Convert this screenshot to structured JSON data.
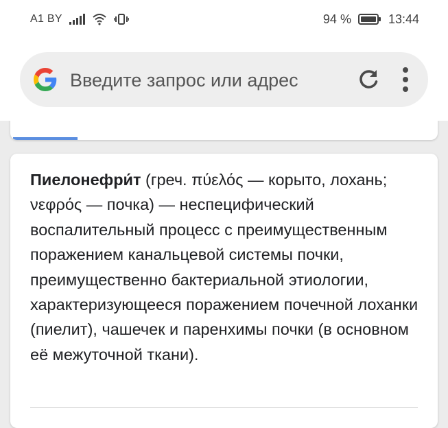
{
  "status_bar": {
    "carrier": "A1 BY",
    "battery_percent": "94 %",
    "time": "13:44"
  },
  "search": {
    "placeholder": "Введите запрос или адрес"
  },
  "card": {
    "term": "Пиелонефри́т",
    "text": " (греч. πύελός — корыто, лохань; νεφρός — почка) — неспецифический воспалительный процесс с преимущественным поражением канальцевой системы почки, преимущественно бактериальной этиологии, характеризующееся поражением почечной лоханки (пиелит), чашечек и паренхимы почки (в основном её межуточной ткани)."
  },
  "colors": {
    "google_blue": "#4285F4",
    "google_red": "#EA4335",
    "google_yellow": "#FBBC05",
    "google_green": "#34A853",
    "accent_tab": "#5b8ee0"
  },
  "icons": [
    "signal-icon",
    "wifi-icon",
    "vibrate-icon",
    "battery-icon",
    "google-logo",
    "reload-icon",
    "more-vert-icon"
  ]
}
